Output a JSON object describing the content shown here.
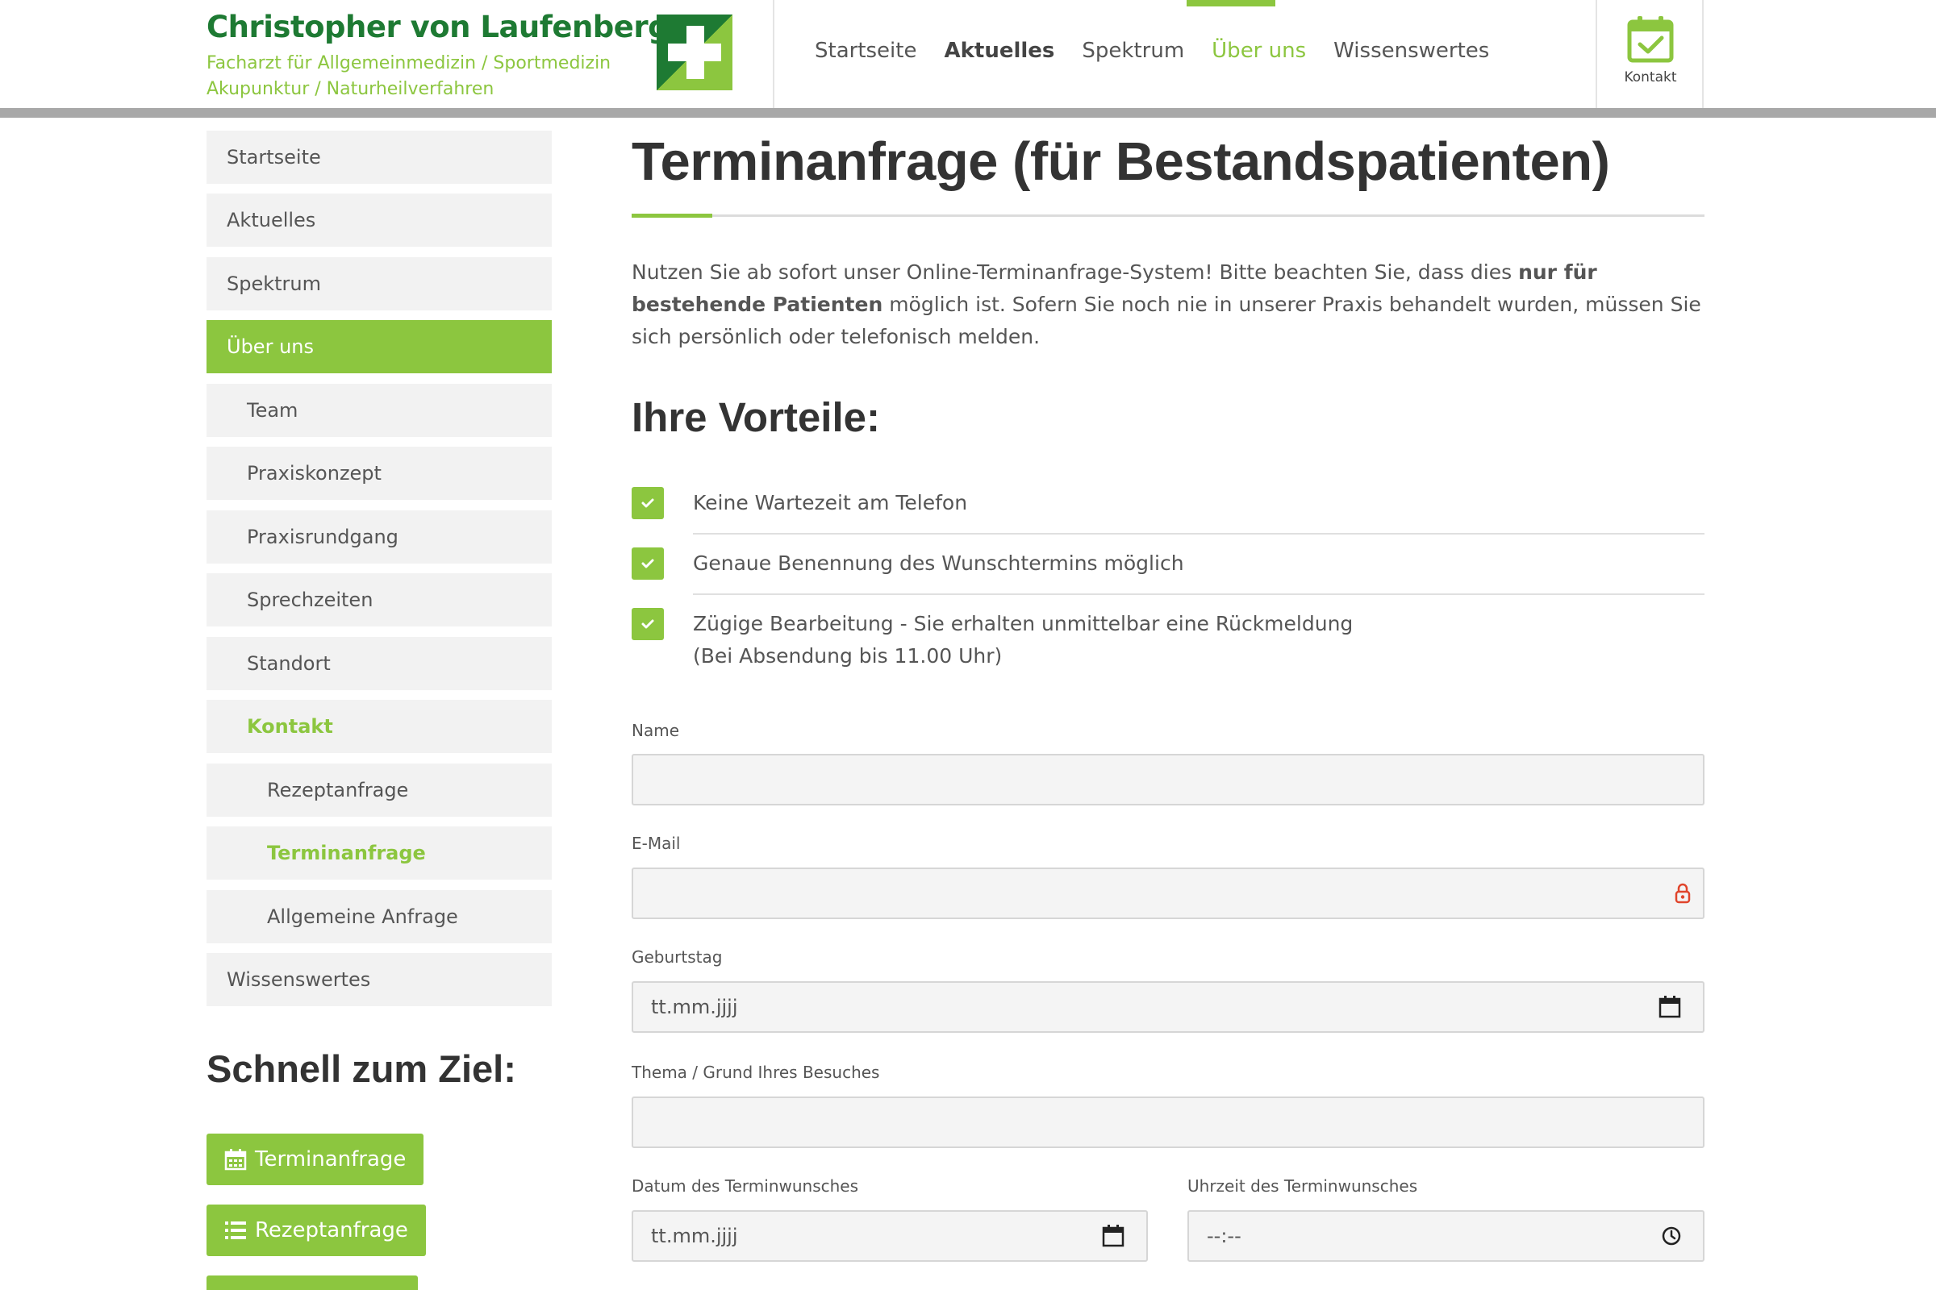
{
  "header": {
    "brand_name": "Christopher von Laufenberg",
    "brand_line1": "Facharzt für Allgemeinmedizin / Sportmedizin",
    "brand_line2": "Akupunktur / Naturheilverfahren",
    "nav": [
      {
        "label": "Startseite"
      },
      {
        "label": "Aktuelles"
      },
      {
        "label": "Spektrum"
      },
      {
        "label": "Über uns"
      },
      {
        "label": "Wissenswertes"
      }
    ],
    "active_nav": "Über uns",
    "contact_label": "Kontakt",
    "contact_icon": "calendar-check-icon"
  },
  "sidebar": {
    "items": [
      {
        "label": "Startseite"
      },
      {
        "label": "Aktuelles"
      },
      {
        "label": "Spektrum"
      },
      {
        "label": "Über uns"
      },
      {
        "label": "Team"
      },
      {
        "label": "Praxiskonzept"
      },
      {
        "label": "Praxisrundgang"
      },
      {
        "label": "Sprechzeiten"
      },
      {
        "label": "Standort"
      },
      {
        "label": "Kontakt"
      },
      {
        "label": "Rezeptanfrage"
      },
      {
        "label": "Terminanfrage"
      },
      {
        "label": "Allgemeine Anfrage"
      },
      {
        "label": "Wissenswertes"
      }
    ],
    "quick_title": "Schnell zum Ziel:",
    "quick_buttons": [
      {
        "label": "Terminanfrage",
        "icon": "calendar-icon"
      },
      {
        "label": "Rezeptanfrage",
        "icon": "list-icon"
      }
    ]
  },
  "main": {
    "title": "Terminanfrage (für Bestandspatienten)",
    "intro_part1": "Nutzen Sie ab sofort unser Online-Terminanfrage-System! Bitte beachten Sie, dass dies ",
    "intro_bold": "nur für bestehende Patienten",
    "intro_part2": " möglich ist. Sofern Sie noch nie in unserer Praxis behandelt wurden, müssen Sie sich persönlich oder telefonisch melden.",
    "advantages_title": "Ihre Vorteile:",
    "advantages": [
      {
        "line1": "Keine Wartezeit am Telefon",
        "line2": ""
      },
      {
        "line1": "Genaue Benennung des Wunschtermins möglich",
        "line2": ""
      },
      {
        "line1": "Zügige Bearbeitung - Sie erhalten unmittelbar eine Rückmeldung",
        "line2": "(Bei Absendung bis 11.00 Uhr)"
      }
    ],
    "form": {
      "name_label": "Name",
      "name_value": "",
      "email_label": "E-Mail",
      "email_value": "",
      "birthday_label": "Geburtstag",
      "birthday_placeholder": "tt.mm.jjjj",
      "topic_label": "Thema / Grund Ihres Besuches",
      "topic_value": "",
      "date_label": "Datum des Terminwunsches",
      "date_placeholder": "tt.mm.jjjj",
      "time_label": "Uhrzeit des Terminwunsches",
      "time_placeholder": "--:--"
    }
  },
  "colors": {
    "accent": "#8cc63f",
    "brand_dark": "#1e7a33",
    "text": "#555555",
    "heading": "#333333"
  }
}
